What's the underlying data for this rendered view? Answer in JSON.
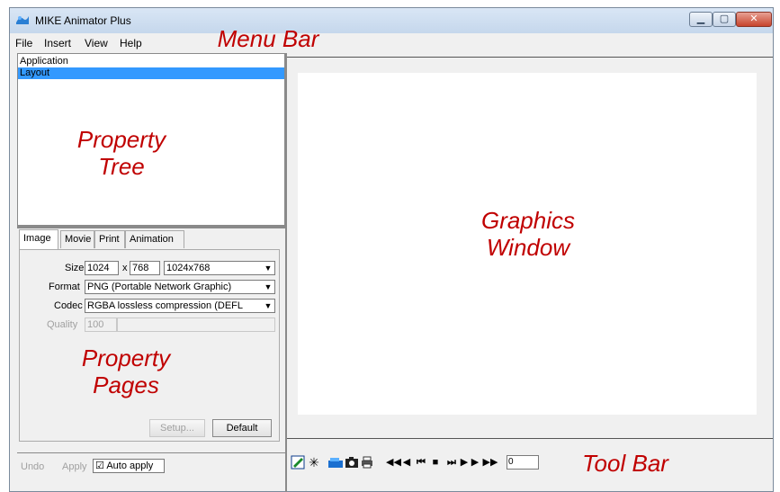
{
  "window": {
    "title": "MIKE Animator Plus"
  },
  "menu": [
    "File",
    "Insert",
    "View",
    "Help"
  ],
  "tree": {
    "items": [
      "Application",
      "Layout"
    ]
  },
  "tabs": [
    "Image",
    "Movie",
    "Print",
    "Animation"
  ],
  "image_page": {
    "size_label": "Size",
    "width": "1024",
    "x_label": "x",
    "height": "768",
    "size_preset": "1024x768",
    "format_label": "Format",
    "format_value": "PNG (Portable Network Graphic)",
    "codec_label": "Codec",
    "codec_value": "RGBA lossless compression (DEFL",
    "quality_label": "Quality",
    "quality_value": "100",
    "setup_button": "Setup...",
    "default_button": "Default"
  },
  "bottom": {
    "undo": "Undo",
    "apply": "Apply",
    "auto_apply": "Auto apply",
    "auto_apply_checked": true
  },
  "toolbar": {
    "frame_value": "0"
  },
  "annotations": {
    "menu_bar": "Menu Bar",
    "property_tree": "Property Tree",
    "property_pages": "Property Pages",
    "graphics_window": "Graphics Window",
    "tool_bar": "Tool Bar"
  }
}
